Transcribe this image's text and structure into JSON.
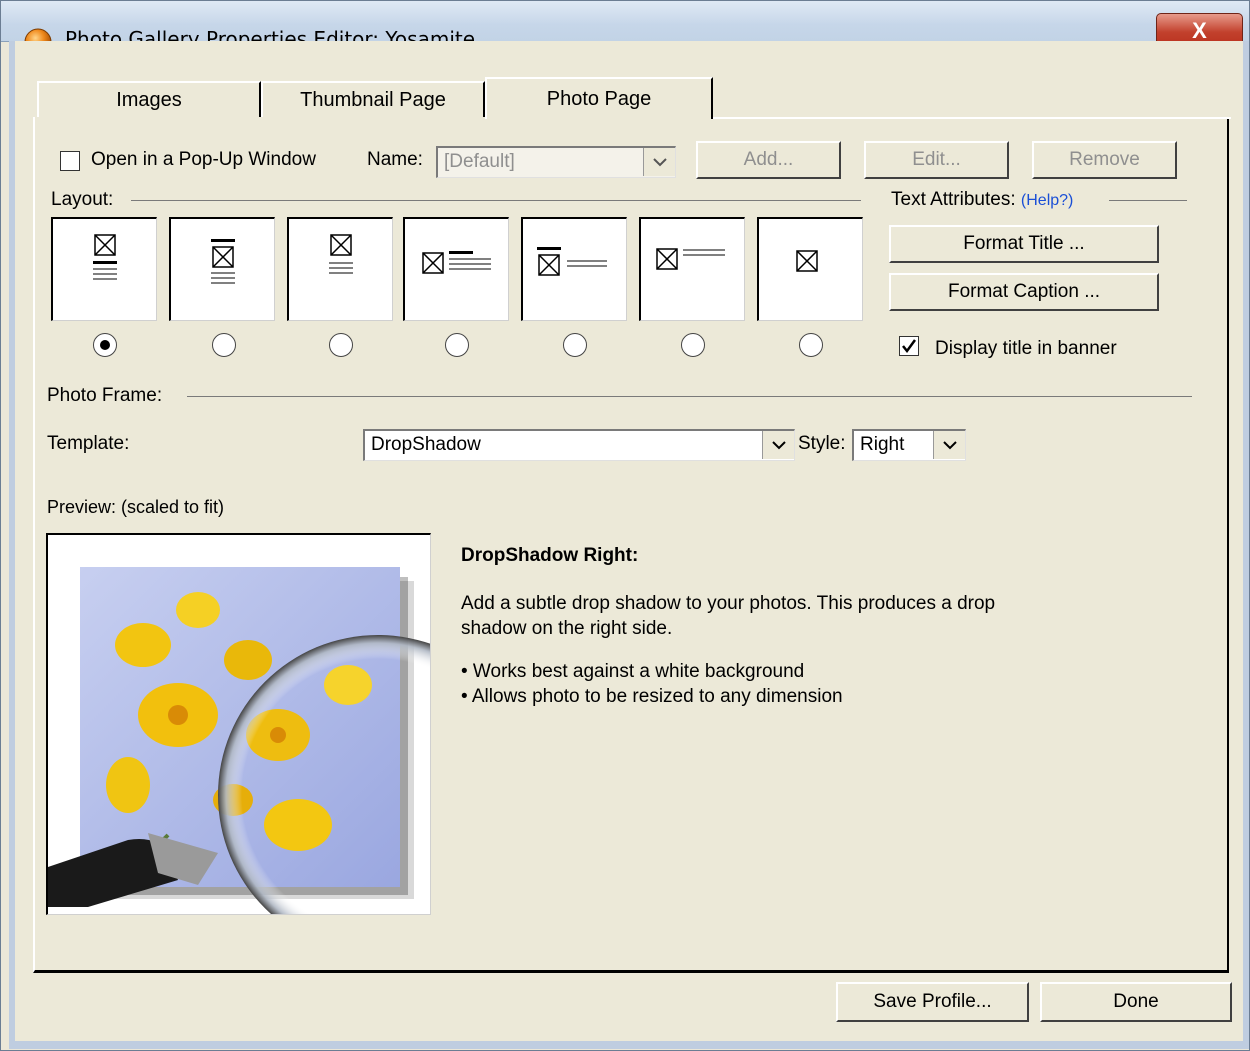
{
  "window": {
    "title": "Photo Gallery Properties Editor: Yosamite",
    "close_label": "X"
  },
  "tabs": [
    {
      "label": "Images"
    },
    {
      "label": "Thumbnail Page"
    },
    {
      "label": "Photo Page"
    }
  ],
  "popup": {
    "label": "Open in a Pop-Up Window",
    "checked": false
  },
  "name_field": {
    "label": "Name:",
    "value": "[Default]"
  },
  "buttons": {
    "add": "Add...",
    "edit": "Edit...",
    "remove": "Remove",
    "format_title": "Format Title ...",
    "format_caption": "Format Caption ...",
    "save_profile": "Save Profile...",
    "done": "Done"
  },
  "layout": {
    "label": "Layout:",
    "selected_index": 0,
    "option_count": 7
  },
  "text_attributes": {
    "label": "Text Attributes:",
    "help": "(Help?)"
  },
  "display_title": {
    "label": "Display title in banner",
    "checked": true
  },
  "photo_frame": {
    "label": "Photo Frame:"
  },
  "template": {
    "label": "Template:",
    "value": "DropShadow"
  },
  "style": {
    "label": "Style:",
    "value": "Right"
  },
  "preview": {
    "label": "Preview: (scaled to fit)"
  },
  "description": {
    "heading": "DropShadow Right:",
    "line1": "Add a subtle drop shadow to your photos. This produces a drop",
    "line2": "shadow on the right side.",
    "bullet1": "• Works best against a white background",
    "bullet2": "• Allows photo to be resized to any dimension"
  },
  "colors": {
    "title_bar": "#c6d6e9",
    "close_red": "#c2412d",
    "dialog_bg": "#ece9d8",
    "help_link": "#1a4fd6"
  }
}
